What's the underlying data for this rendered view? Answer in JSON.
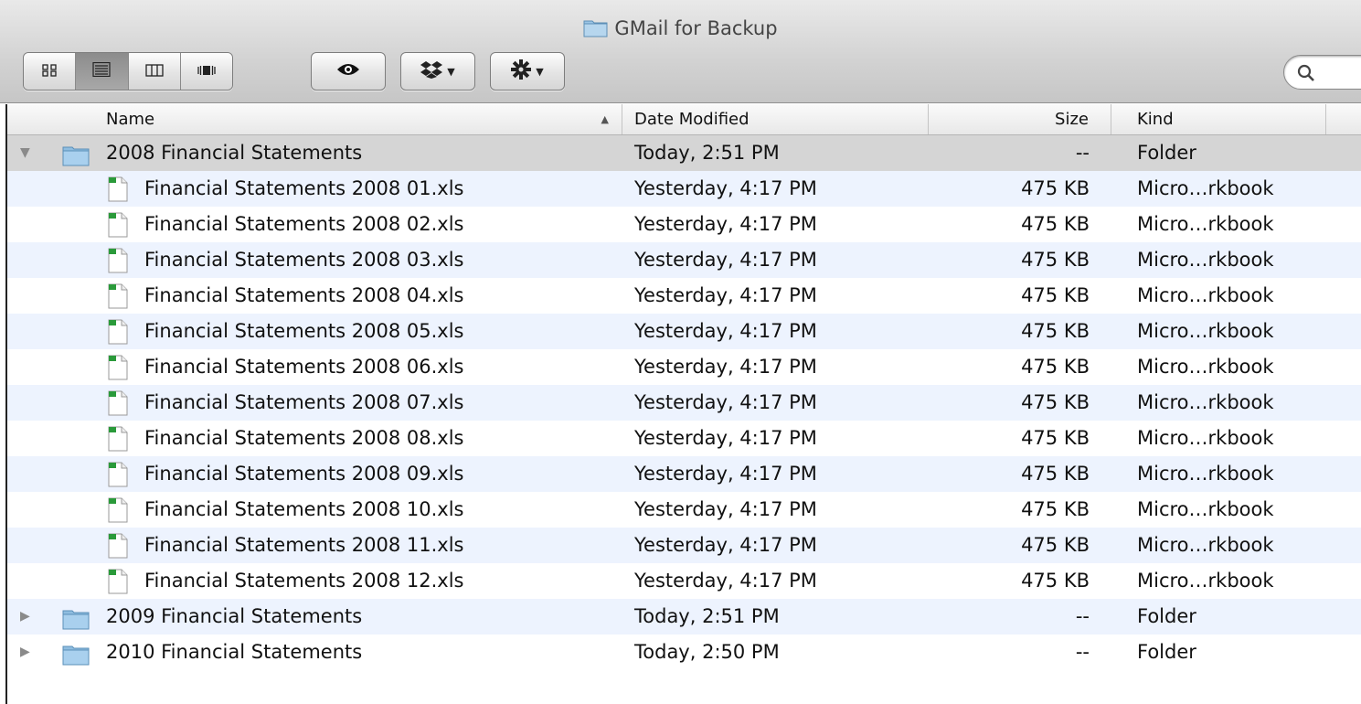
{
  "window": {
    "title": "GMail for Backup"
  },
  "toolbar": {
    "view_buttons": [
      {
        "name": "icon-view",
        "active": false
      },
      {
        "name": "list-view",
        "active": true
      },
      {
        "name": "column-view",
        "active": false
      },
      {
        "name": "coverflow-view",
        "active": false
      }
    ]
  },
  "columns": {
    "name": "Name",
    "date": "Date Modified",
    "size": "Size",
    "kind": "Kind"
  },
  "rows": [
    {
      "type": "folder",
      "expanded": true,
      "name": "2008 Financial Statements",
      "date": "Today, 2:51 PM",
      "size": "--",
      "kind": "Folder"
    },
    {
      "type": "file",
      "name": "Financial Statements 2008 01.xls",
      "date": "Yesterday, 4:17 PM",
      "size": "475 KB",
      "kind": "Micro…rkbook"
    },
    {
      "type": "file",
      "name": "Financial Statements 2008 02.xls",
      "date": "Yesterday, 4:17 PM",
      "size": "475 KB",
      "kind": "Micro…rkbook"
    },
    {
      "type": "file",
      "name": "Financial Statements 2008 03.xls",
      "date": "Yesterday, 4:17 PM",
      "size": "475 KB",
      "kind": "Micro…rkbook"
    },
    {
      "type": "file",
      "name": "Financial Statements 2008 04.xls",
      "date": "Yesterday, 4:17 PM",
      "size": "475 KB",
      "kind": "Micro…rkbook"
    },
    {
      "type": "file",
      "name": "Financial Statements 2008 05.xls",
      "date": "Yesterday, 4:17 PM",
      "size": "475 KB",
      "kind": "Micro…rkbook"
    },
    {
      "type": "file",
      "name": "Financial Statements 2008 06.xls",
      "date": "Yesterday, 4:17 PM",
      "size": "475 KB",
      "kind": "Micro…rkbook"
    },
    {
      "type": "file",
      "name": "Financial Statements 2008 07.xls",
      "date": "Yesterday, 4:17 PM",
      "size": "475 KB",
      "kind": "Micro…rkbook"
    },
    {
      "type": "file",
      "name": "Financial Statements 2008 08.xls",
      "date": "Yesterday, 4:17 PM",
      "size": "475 KB",
      "kind": "Micro…rkbook"
    },
    {
      "type": "file",
      "name": "Financial Statements 2008 09.xls",
      "date": "Yesterday, 4:17 PM",
      "size": "475 KB",
      "kind": "Micro…rkbook"
    },
    {
      "type": "file",
      "name": "Financial Statements 2008 10.xls",
      "date": "Yesterday, 4:17 PM",
      "size": "475 KB",
      "kind": "Micro…rkbook"
    },
    {
      "type": "file",
      "name": "Financial Statements 2008 11.xls",
      "date": "Yesterday, 4:17 PM",
      "size": "475 KB",
      "kind": "Micro…rkbook"
    },
    {
      "type": "file",
      "name": "Financial Statements 2008 12.xls",
      "date": "Yesterday, 4:17 PM",
      "size": "475 KB",
      "kind": "Micro…rkbook"
    },
    {
      "type": "folder",
      "expanded": false,
      "name": "2009 Financial Statements",
      "date": "Today, 2:51 PM",
      "size": "--",
      "kind": "Folder"
    },
    {
      "type": "folder",
      "expanded": false,
      "name": "2010 Financial Statements",
      "date": "Today, 2:50 PM",
      "size": "--",
      "kind": "Folder"
    }
  ],
  "colors": {
    "selected_row": "#d5d5d5",
    "alt_row": "#edf3fe",
    "folder_blue": "#7fb2d9"
  }
}
